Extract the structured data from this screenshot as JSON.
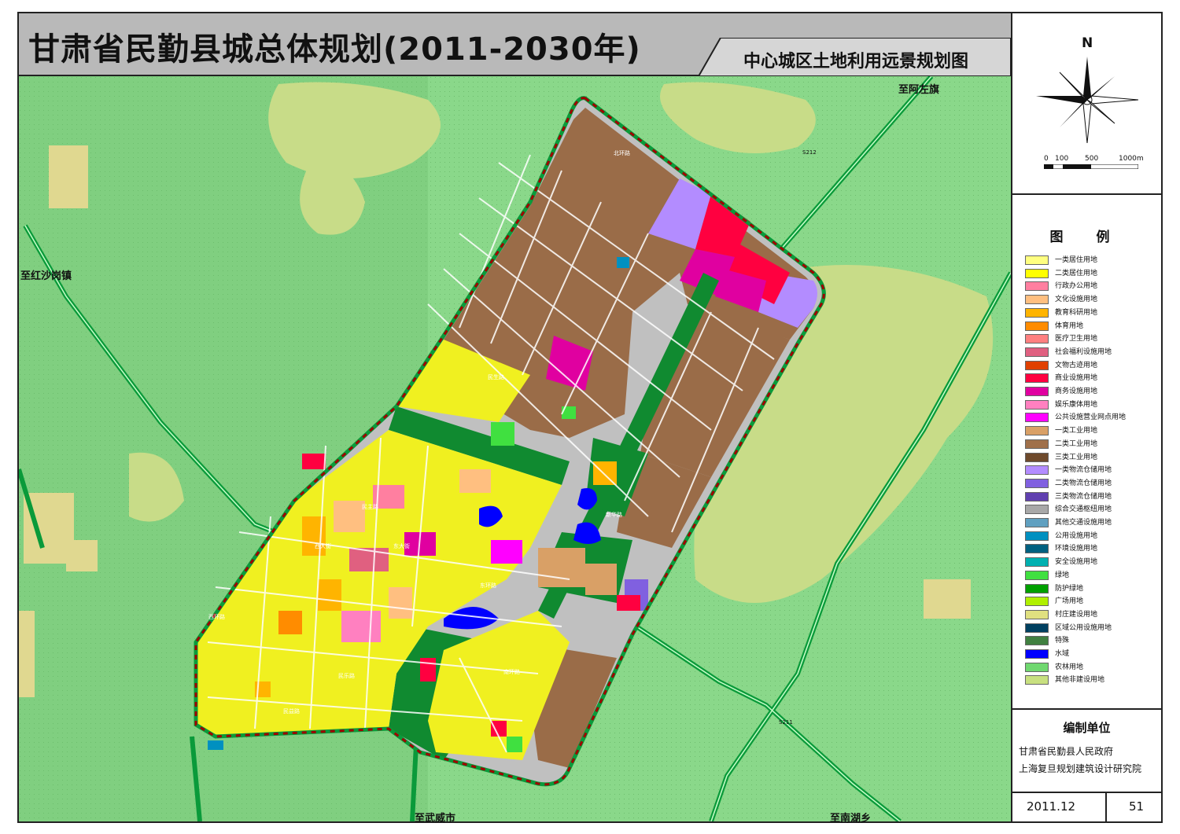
{
  "header": {
    "title": "甘肃省民勤县城总体规划(2011-2030年)",
    "subtitle": "中心城区土地利用远景规划图"
  },
  "compass": {
    "north": "N"
  },
  "scale": {
    "labels": [
      "0",
      "100",
      "500",
      "1000m"
    ]
  },
  "destinations": {
    "north": "至阿左旗",
    "west": "至红沙岗镇",
    "south": "至武威市",
    "southeast": "至南湖乡"
  },
  "road_labels": [
    "北环路",
    "民生路",
    "民主路",
    "新华路",
    "西环路",
    "东环路",
    "东大街",
    "西大街",
    "南环路",
    "民乐路",
    "民益路",
    "S212",
    "S211"
  ],
  "legend": {
    "title": "图 例",
    "items": [
      {
        "label": "一类居住用地",
        "color": "#ffff80"
      },
      {
        "label": "二类居住用地",
        "color": "#ffff00"
      },
      {
        "label": "行政办公用地",
        "color": "#ff7fa0"
      },
      {
        "label": "文化设施用地",
        "color": "#ffbf80"
      },
      {
        "label": "教育科研用地",
        "color": "#ffb400"
      },
      {
        "label": "体育用地",
        "color": "#ff8c00"
      },
      {
        "label": "医疗卫生用地",
        "color": "#ff8080"
      },
      {
        "label": "社会福利设施用地",
        "color": "#e06080"
      },
      {
        "label": "文物古迹用地",
        "color": "#e04000"
      },
      {
        "label": "商业设施用地",
        "color": "#ff0040"
      },
      {
        "label": "商务设施用地",
        "color": "#e000a0"
      },
      {
        "label": "娱乐康体用地",
        "color": "#ff80c0"
      },
      {
        "label": "公共设施营业网点用地",
        "color": "#ff00ff"
      },
      {
        "label": "一类工业用地",
        "color": "#d9a066"
      },
      {
        "label": "二类工业用地",
        "color": "#a0704a"
      },
      {
        "label": "三类工业用地",
        "color": "#6e4a2c"
      },
      {
        "label": "一类物流仓储用地",
        "color": "#b38cff"
      },
      {
        "label": "二类物流仓储用地",
        "color": "#8060e0"
      },
      {
        "label": "三类物流仓储用地",
        "color": "#6040b0"
      },
      {
        "label": "综合交通枢纽用地",
        "color": "#a8a8a8"
      },
      {
        "label": "其他交通设施用地",
        "color": "#60a0c0"
      },
      {
        "label": "公用设施用地",
        "color": "#0090c0"
      },
      {
        "label": "环境设施用地",
        "color": "#006080"
      },
      {
        "label": "安全设施用地",
        "color": "#00b0b0"
      },
      {
        "label": "绿地",
        "color": "#40e040"
      },
      {
        "label": "防护绿地",
        "color": "#00a000"
      },
      {
        "label": "广场用地",
        "color": "#b0f000"
      },
      {
        "label": "村庄建设用地",
        "color": "#e0e080"
      },
      {
        "label": "区域公用设施用地",
        "color": "#004060"
      },
      {
        "label": "特殊",
        "color": "#408040"
      },
      {
        "label": "水域",
        "color": "#0000ff"
      },
      {
        "label": "农林用地",
        "color": "#70d870"
      },
      {
        "label": "其他非建设用地",
        "color": "#c8e080"
      }
    ]
  },
  "compiler": {
    "title": "编制单位",
    "names": [
      "甘肃省民勤县人民政府",
      "上海复旦规划建筑设计研究院"
    ]
  },
  "footer": {
    "date": "2011.12",
    "page": "51"
  }
}
